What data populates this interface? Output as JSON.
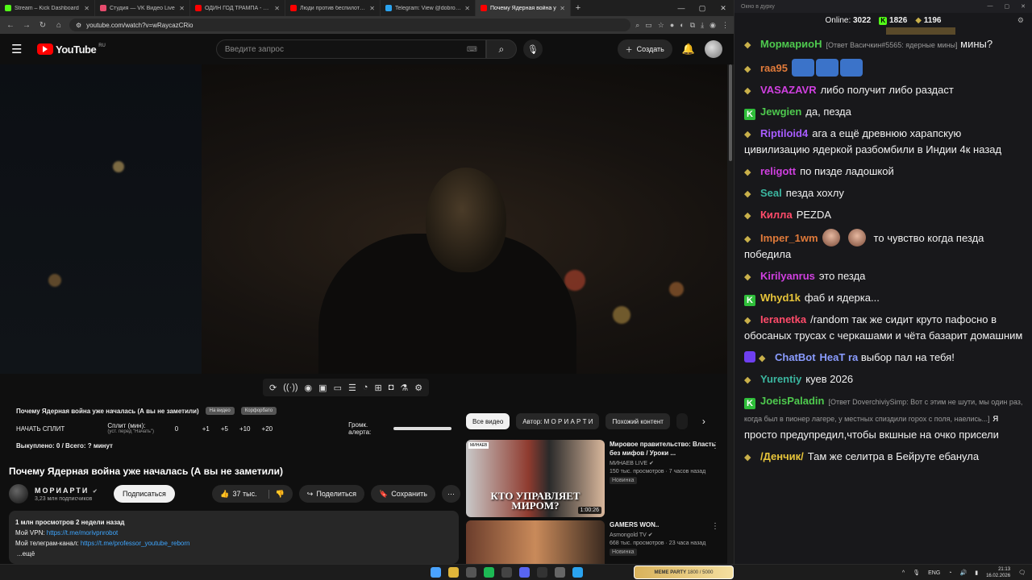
{
  "browser": {
    "tabs": [
      {
        "label": "Stream – Kick Dashboard",
        "color": "#53fc18"
      },
      {
        "label": "Студия — VK Видео Live",
        "color": "#e64b6d"
      },
      {
        "label": "ОДИН ГОД ТРАМПА - YouTub",
        "color": "#ff0000"
      },
      {
        "label": "Люди против беспилотия: секр",
        "color": "#ff0000"
      },
      {
        "label": "Telegram: View @dobro_2ch",
        "color": "#2aa3ef"
      },
      {
        "label": "Почему Ядерная война у",
        "color": "#ff0000"
      }
    ],
    "url": "youtube.com/watch?v=wRaycazCRio"
  },
  "youtube": {
    "logo_text": "YouTube",
    "region": "RU",
    "search_placeholder": "Введите запрос",
    "create_label": "Создать"
  },
  "extension": {
    "title": "Почему Ядерная война уже началась (А вы не заметили)",
    "chip1": "На видео",
    "chip2": "Корфорбато",
    "split_label": "НАЧАТЬ СПЛИТ",
    "split_min_label": "Сплит (мин):",
    "split_min_hint": "(уст. перед \"Начать\")",
    "counter": "0",
    "increments": [
      "+1",
      "+5",
      "+10",
      "+20"
    ],
    "volume_label": "Громк. алерта:",
    "paid": "Выкуплено: 0 / Всего: ? минут"
  },
  "video": {
    "title": "Почему Ядерная война уже началась (А вы не заметили)",
    "channel": "МОРИАРТИ",
    "subscribers": "3,23 млн подписчиков",
    "subscribe_label": "Подписаться",
    "likes": "37 тыс.",
    "share_label": "Поделиться",
    "save_label": "Сохранить",
    "desc_stats": "1 млн просмотров  2 недели назад",
    "desc_vpn_label": "Мой VPN: ",
    "desc_vpn_link": "https://t.me/morivpnrobot",
    "desc_tg_label": "Мой телеграм-канал: ",
    "desc_tg_link": "https://t.me/professor_youtube_reborn",
    "desc_more": "...ещё"
  },
  "recommendations": {
    "filters": [
      "Все видео",
      "Автор: М О Р И А Р Т И",
      "Похожий контент"
    ],
    "items": [
      {
        "title": "Мировое правительство: Власть без мифов / Уроки ...",
        "channel": "МИНАЕВ LIVE",
        "meta": "150 тыс. просмотров · 7 часов назад",
        "badge": "Новинка",
        "duration": "1:00:26",
        "thumb_text": "КТО УПРАВЛЯЕТ МИРОМ?",
        "thumb_badge": "МИНАЕВ"
      },
      {
        "title": "GAMERS WON..",
        "channel": "Asmongold TV",
        "meta": "668 тыс. просмотров · 23 часа назад",
        "badge": "Новинка",
        "duration": "",
        "thumb_text": "",
        "thumb_badge": ""
      }
    ]
  },
  "chat": {
    "window_title": "Окно в дурку",
    "online_label": "Online:",
    "online": "3022",
    "kick_count": "1826",
    "other_count": "1196",
    "messages": [
      {
        "user": "МормариоН",
        "color": "#4ec94e",
        "reply": "[Ответ Васичкин#5565: ядерные мины]",
        "text": "мины?",
        "badge": "bird"
      },
      {
        "user": "raa95",
        "color": "#e07a3a",
        "text": "",
        "badge": "bird",
        "emotes": 3
      },
      {
        "user": "VASAZAVR",
        "color": "#d040e0",
        "text": "либо получит либо раздаст",
        "badge": "bird"
      },
      {
        "user": "Jewgien",
        "color": "#4ec94e",
        "text": "да, пезда",
        "badge": "k"
      },
      {
        "user": "Riptiloid4",
        "color": "#a85cff",
        "text": "ага а ещё древнюю харапскую цивилизацию ядеркой разбомбили в Индии 4к назад",
        "badge": "bird"
      },
      {
        "user": "religott",
        "color": "#d040e0",
        "text": "по пизде ладошкой",
        "badge": "bird"
      },
      {
        "user": "Seal",
        "color": "#3bb6a0",
        "text": "пезда хохлу",
        "badge": "bird"
      },
      {
        "user": "Килла",
        "color": "#ff4b6a",
        "text": "PEZDA",
        "badge": "bird"
      },
      {
        "user": "Imper_1wm",
        "color": "#e07a3a",
        "text": "то чувство когда пезда победила",
        "badge": "bird",
        "faces": 2
      },
      {
        "user": "Kirilyanrus",
        "color": "#d040e0",
        "text": "это пезда",
        "badge": "bird"
      },
      {
        "user": "Whyd1k",
        "color": "#e8c53a",
        "text": "фаб и ядерка...",
        "badge": "k"
      },
      {
        "user": "Ieranetka",
        "color": "#ff4b6a",
        "text": "/random так же сидит круто пафосно в обосаных трусах с черкашами и чёта базарит домашним",
        "badge": "bird"
      },
      {
        "user": "ChatBot",
        "color": "#8a9cff",
        "text": "HeaT ra выбор пал на тебя!",
        "badge": "heat",
        "hl": "HeaT ra",
        "hl_color": "#8a9cff",
        "rest": "выбор пал на тебя!"
      },
      {
        "user": "Yurentiy",
        "color": "#3bb6a0",
        "text": "куев 2026",
        "badge": "bird"
      },
      {
        "user": "JoeisPaladin",
        "color": "#4ec94e",
        "reply": "[Ответ DoverchiviySimp: Вот с этим не шути, мы один раз, когда был в пионер лагере, у местных спиздили горох с поля, наелись...]",
        "text": "я просто предупредил,чтобы вкшные на очко присели",
        "badge": "k"
      },
      {
        "user": "/Денчик/",
        "color": "#e8c53a",
        "text": "Там же селитра в Бейруте ебанула",
        "badge": "bird"
      }
    ]
  },
  "taskbar": {
    "meme_label": "MEME PARTY",
    "meme_progress": "1800 / 5000",
    "lang": "ENG",
    "time": "21:13",
    "date": "16.02.2026"
  }
}
